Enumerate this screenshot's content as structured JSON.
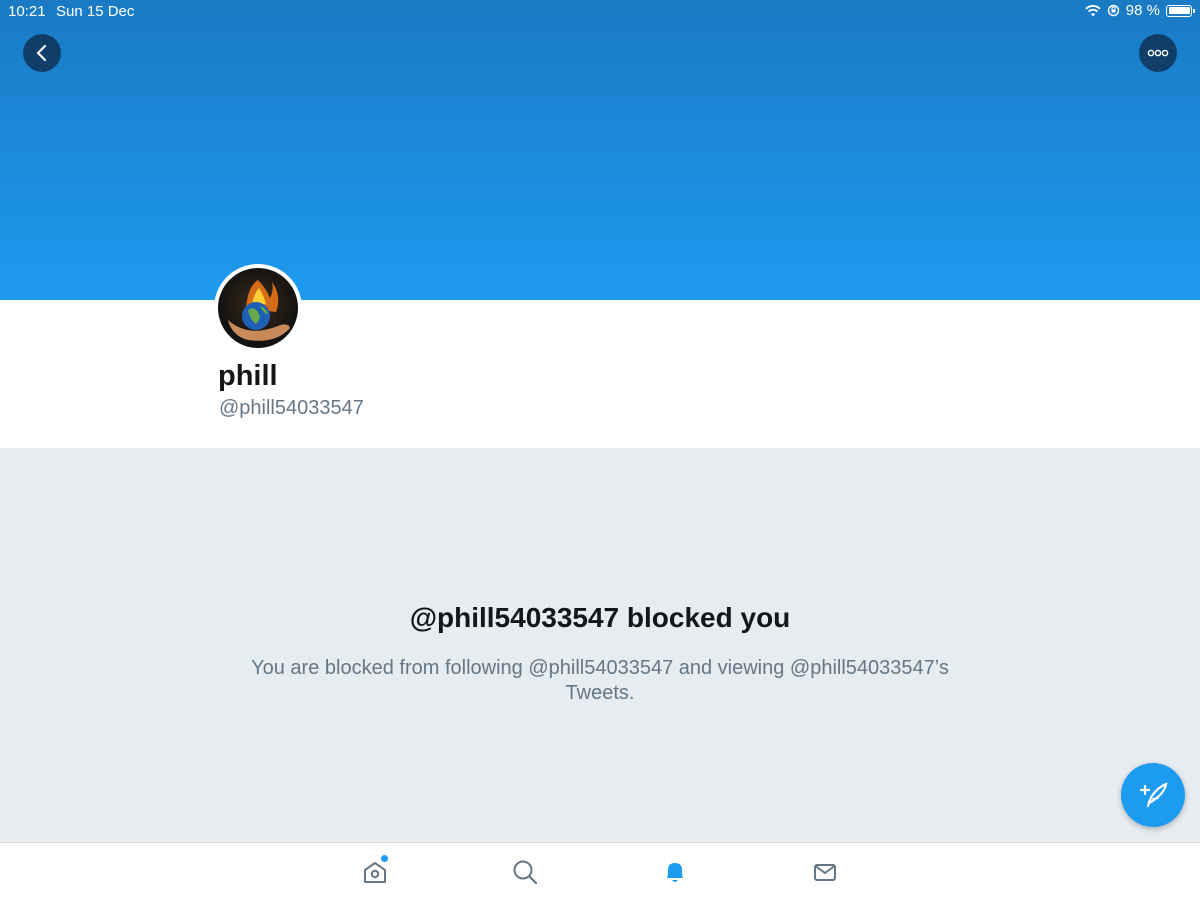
{
  "status_bar": {
    "time": "10:21",
    "date": "Sun 15 Dec",
    "battery": "98 %"
  },
  "header": {
    "back_icon": "chevron-left-icon",
    "more_icon": "more-horizontal-icon"
  },
  "profile": {
    "name": "phill",
    "handle": "@phill54033547"
  },
  "blocked": {
    "title": "@phill54033547 blocked you",
    "description": "You are blocked from following @phill54033547 and viewing @phill54033547’s Tweets."
  },
  "compose": {
    "icon": "compose-feather-icon"
  },
  "tab_bar": {
    "tabs": [
      {
        "icon": "home-icon",
        "active": false,
        "has_dot": true
      },
      {
        "icon": "search-icon",
        "active": false
      },
      {
        "icon": "notifications-bell-icon",
        "active": true
      },
      {
        "icon": "messages-envelope-icon",
        "active": false
      }
    ]
  },
  "colors": {
    "accent": "#1d9bf0",
    "text_primary": "#14171a",
    "text_secondary": "#657786",
    "background": "#e6ecf0"
  }
}
